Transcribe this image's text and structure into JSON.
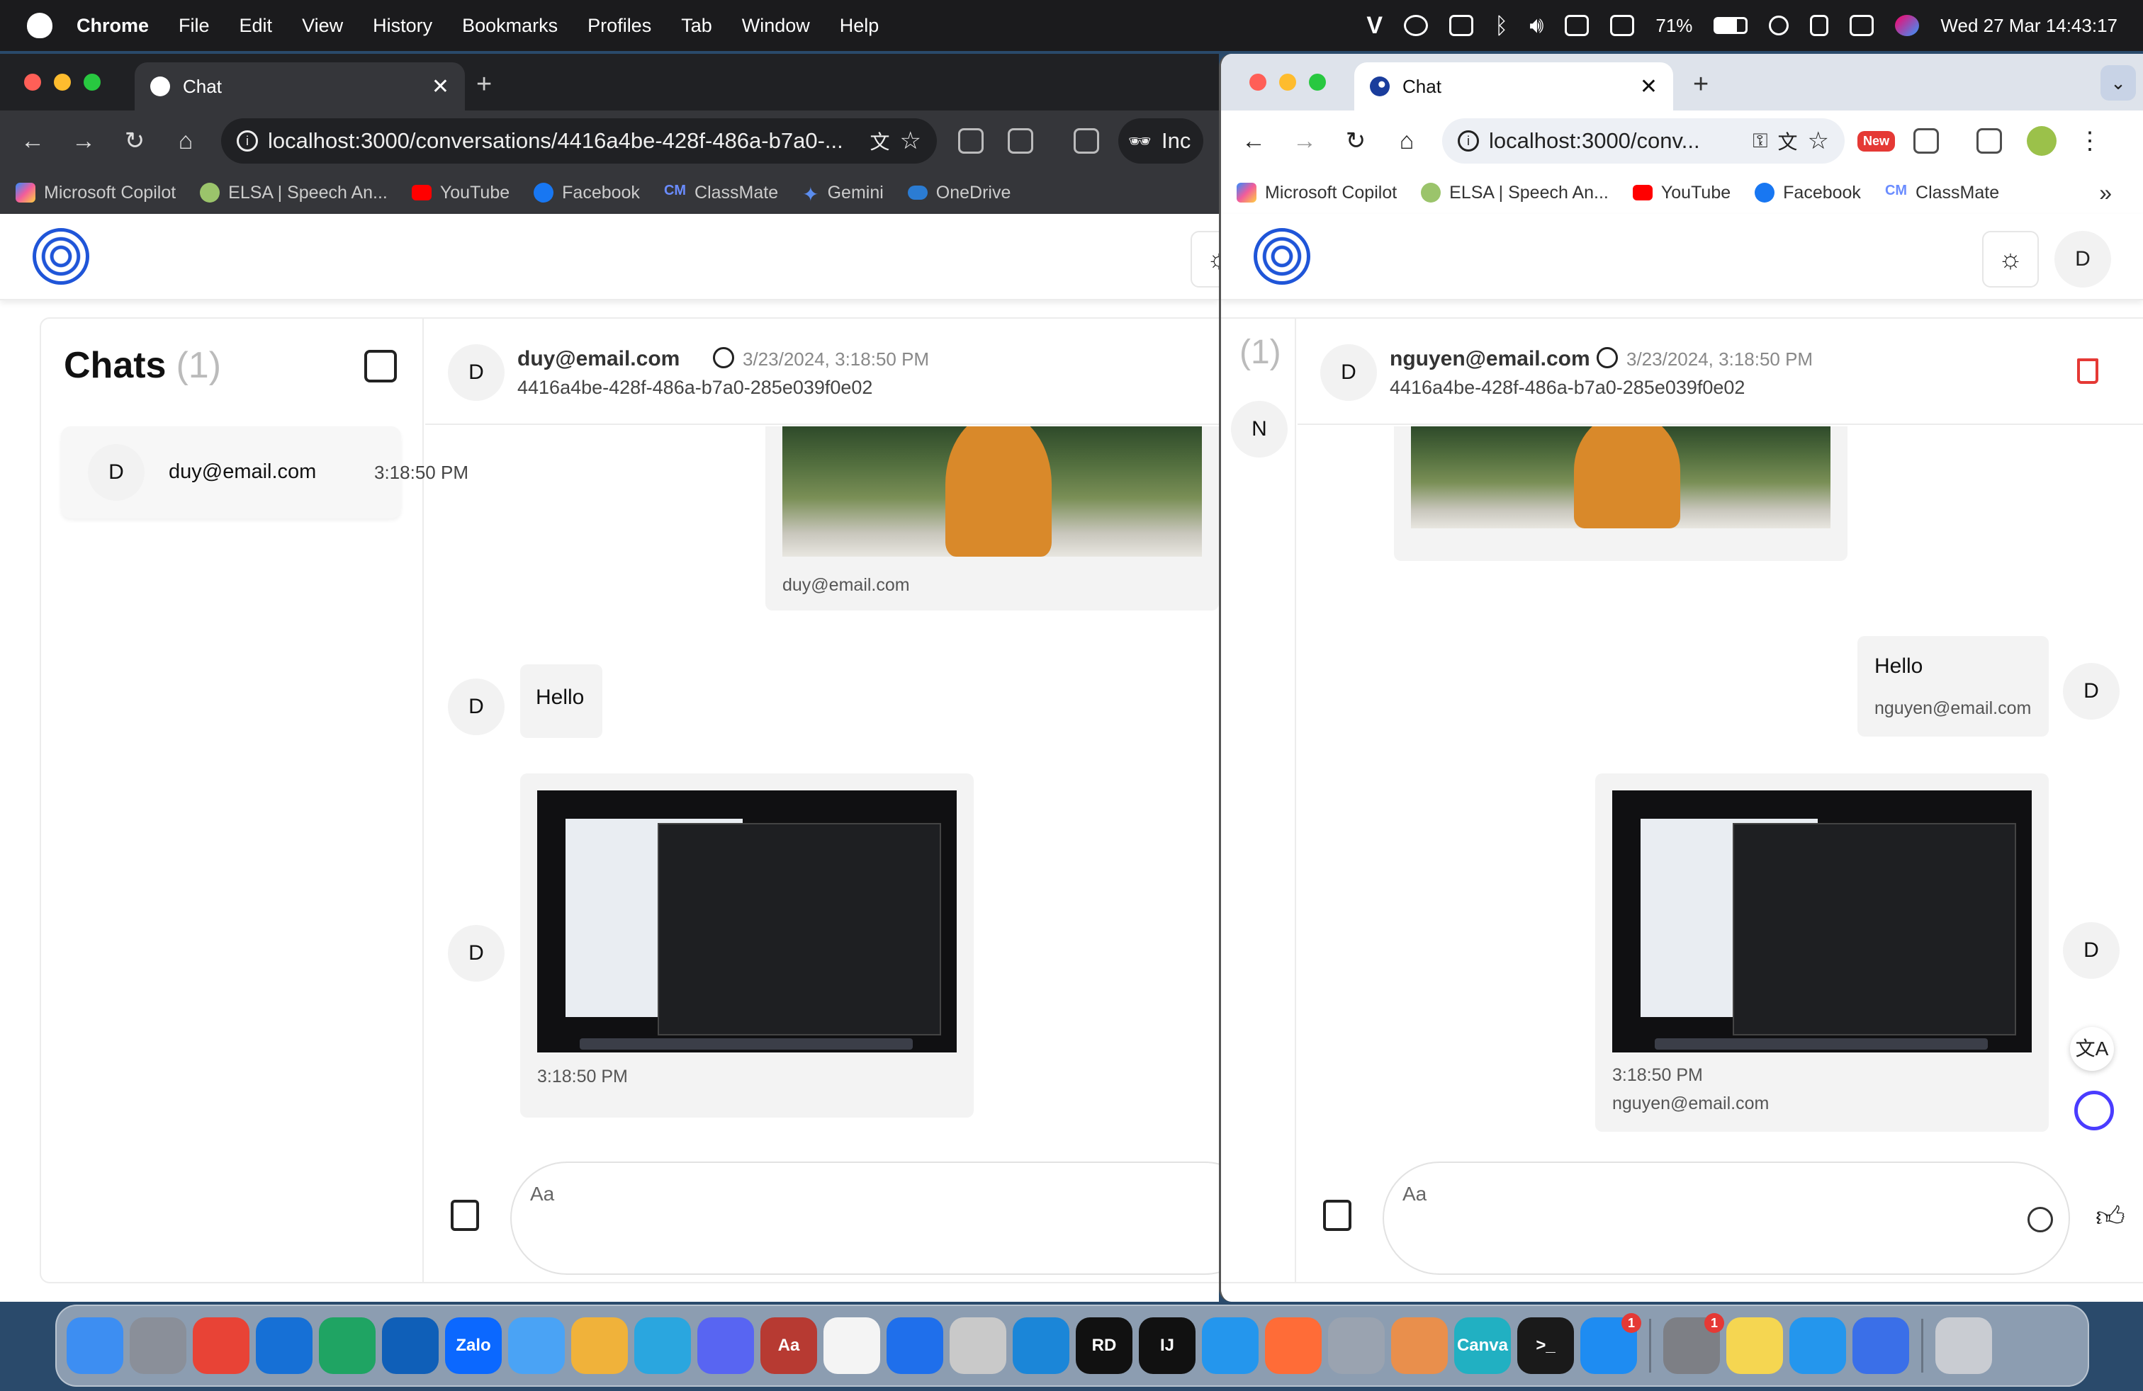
{
  "menubar": {
    "app": "Chrome",
    "items": [
      "File",
      "Edit",
      "View",
      "History",
      "Bookmarks",
      "Profiles",
      "Tab",
      "Window",
      "Help"
    ],
    "battery": "71%",
    "datetime": "Wed 27 Mar  14:43:17"
  },
  "left_window": {
    "tab_title": "Chat",
    "url": "localhost:3000/conversations/4416a4be-428f-486a-b7a0-...",
    "extra_text": "Inc",
    "bookmarks": [
      "Microsoft Copilot",
      "ELSA | Speech An...",
      "YouTube",
      "Facebook",
      "ClassMate",
      "Gemini",
      "OneDrive"
    ],
    "sidebar": {
      "title": "Chats",
      "count": "(1)",
      "conversation": {
        "avatar": "D",
        "email": "duy@email.com",
        "time": "3:18:50 PM"
      }
    },
    "header": {
      "avatar": "D",
      "email": "duy@email.com",
      "date": "3/23/2024, 3:18:50 PM",
      "conversation_id": "4416a4be-428f-486a-b7a0-285e039f0e02"
    },
    "messages": [
      {
        "type": "image",
        "caption": "duy@email.com"
      },
      {
        "type": "text",
        "avatar": "D",
        "text": "Hello"
      },
      {
        "type": "image",
        "avatar": "D",
        "time": "3:18:50 PM"
      }
    ],
    "composer_placeholder": "Aa"
  },
  "right_window": {
    "tab_title": "Chat",
    "url": "localhost:3000/conv...",
    "new_badge": "New",
    "bookmarks": [
      "Microsoft Copilot",
      "ELSA | Speech An...",
      "YouTube",
      "Facebook",
      "ClassMate"
    ],
    "user_avatar": "D",
    "sidebar": {
      "count": "(1)",
      "avatar": "N"
    },
    "header": {
      "avatar": "D",
      "email": "nguyen@email.com",
      "date": "3/23/2024, 3:18:50 PM",
      "conversation_id": "4416a4be-428f-486a-b7a0-285e039f0e02"
    },
    "messages": [
      {
        "type": "image"
      },
      {
        "type": "text",
        "avatar": "D",
        "text": "Hello",
        "sender": "nguyen@email.com"
      },
      {
        "type": "image",
        "avatar": "D",
        "time": "3:18:50 PM",
        "sender": "nguyen@email.com"
      }
    ],
    "composer_placeholder": "Aa"
  },
  "dock": {
    "apps": [
      {
        "name": "finder-icon",
        "color": "#3d8ef2",
        "label": ""
      },
      {
        "name": "launchpad-icon",
        "color": "#8a8f99",
        "label": ""
      },
      {
        "name": "chrome-icon",
        "color": "#e84336",
        "label": ""
      },
      {
        "name": "onedrive-icon",
        "color": "#1670d6",
        "label": ""
      },
      {
        "name": "google-drive-icon",
        "color": "#1fa463",
        "label": ""
      },
      {
        "name": "outlook-icon",
        "color": "#0f5fb8",
        "label": ""
      },
      {
        "name": "zalo-icon",
        "color": "#0b68ff",
        "label": "Zalo"
      },
      {
        "name": "mail-icon",
        "color": "#4aa3f5",
        "label": ""
      },
      {
        "name": "photos-icon",
        "color": "#f0b23a",
        "label": ""
      },
      {
        "name": "telegram-icon",
        "color": "#2aa6df",
        "label": ""
      },
      {
        "name": "discord-icon",
        "color": "#5865f2",
        "label": ""
      },
      {
        "name": "dictionary-icon",
        "color": "#b73a32",
        "label": "Aa"
      },
      {
        "name": "freeform-icon",
        "color": "#f4f4f4",
        "label": ""
      },
      {
        "name": "notes-app-icon",
        "color": "#1f6feb",
        "label": ""
      },
      {
        "name": "cyberduck-icon",
        "color": "#c9c9c9",
        "label": ""
      },
      {
        "name": "vscode-icon",
        "color": "#1b86d8",
        "label": ""
      },
      {
        "name": "rider-icon",
        "color": "#111111",
        "label": "RD"
      },
      {
        "name": "intellij-icon",
        "color": "#111111",
        "label": "IJ"
      },
      {
        "name": "docker-icon",
        "color": "#2496ed",
        "label": ""
      },
      {
        "name": "postman-icon",
        "color": "#ff6c37",
        "label": ""
      },
      {
        "name": "parallels-icon",
        "color": "#9aa3b0",
        "label": ""
      },
      {
        "name": "affinity-icon",
        "color": "#e98f4c",
        "label": ""
      },
      {
        "name": "canva-icon",
        "color": "#21b0c2",
        "label": "Canva"
      },
      {
        "name": "terminal-icon",
        "color": "#1a1a1a",
        "label": ">_"
      },
      {
        "name": "app-store-icon",
        "color": "#1e8cf2",
        "label": ""
      },
      {
        "name": "system-settings-icon",
        "color": "#7d7f85",
        "label": ""
      },
      {
        "name": "notes-icon",
        "color": "#f5d651",
        "label": ""
      },
      {
        "name": "docker-desktop-icon",
        "color": "#2496ed",
        "label": ""
      },
      {
        "name": "pencil-app-icon",
        "color": "#3a6fe8",
        "label": ""
      },
      {
        "name": "trash-icon",
        "color": "#c9ccd2",
        "label": ""
      }
    ],
    "badges": {
      "app_store": "1",
      "system_settings": "1"
    }
  }
}
